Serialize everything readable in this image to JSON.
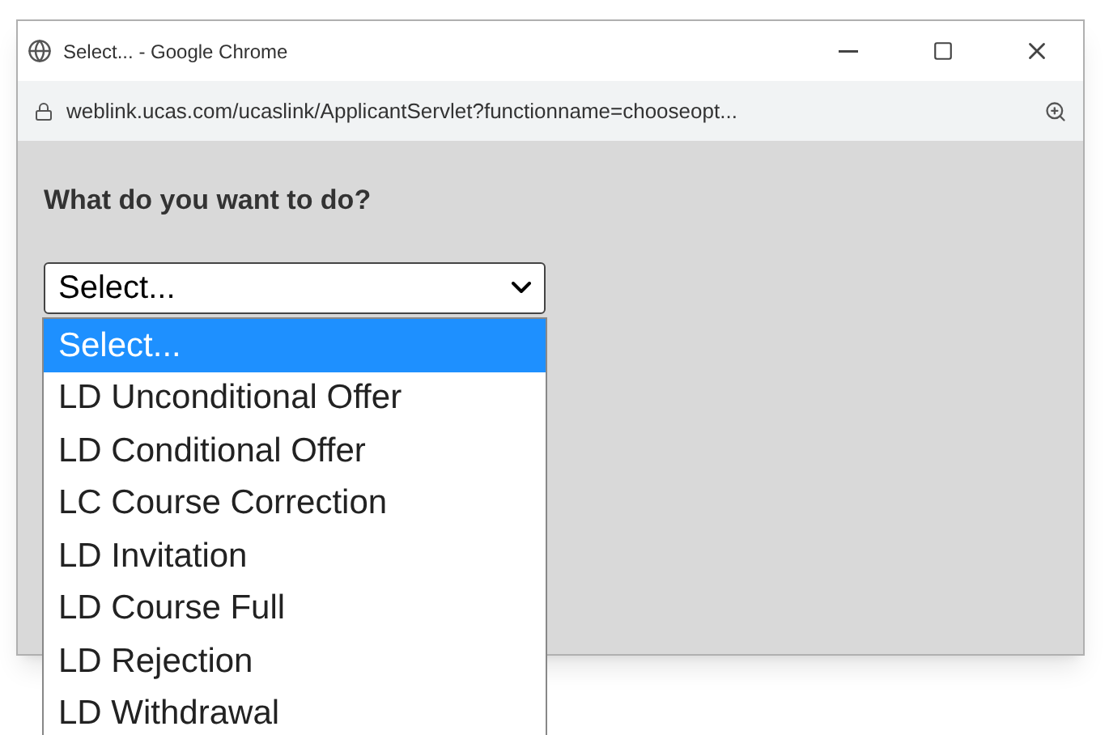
{
  "window": {
    "title": "Select... - Google Chrome"
  },
  "address_bar": {
    "url": "weblink.ucas.com/ucaslink/ApplicantServlet?functionname=chooseopt..."
  },
  "question": "What do you want to do?",
  "select": {
    "value": "Select...",
    "expanded": true
  },
  "options": [
    {
      "label": "Select...",
      "selected": true
    },
    {
      "label": "LD Unconditional Offer",
      "selected": false
    },
    {
      "label": "LD Conditional Offer",
      "selected": false
    },
    {
      "label": "LC Course Correction",
      "selected": false
    },
    {
      "label": "LD Invitation",
      "selected": false
    },
    {
      "label": "LD Course Full",
      "selected": false
    },
    {
      "label": "LD Rejection",
      "selected": false
    },
    {
      "label": "LD Withdrawal",
      "selected": false
    }
  ]
}
